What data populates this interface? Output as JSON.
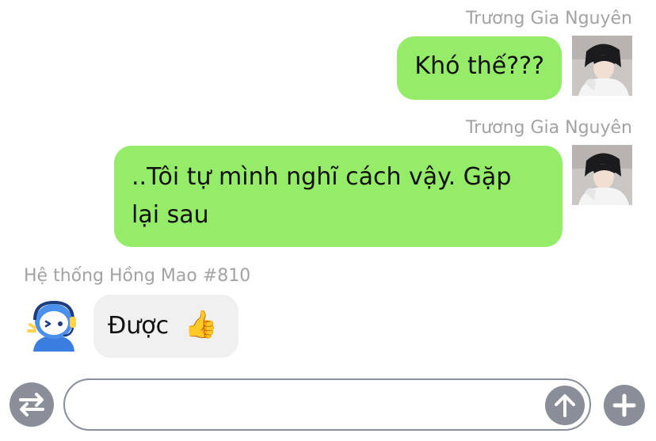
{
  "messages": [
    {
      "sender": "Trương Gia Nguyên",
      "text": "Khó thế???",
      "avatar_icon": "boy-avatar-icon"
    },
    {
      "sender": "Trương Gia Nguyên",
      "text": "..Tôi tự mình nghĩ cách vậy. Gặp lại sau",
      "avatar_icon": "boy-avatar-icon"
    },
    {
      "sender": "Hệ thống Hồng Mao #810",
      "text": "Được",
      "emoji": "👍",
      "avatar_icon": "robot-headset-avatar-icon"
    }
  ],
  "input": {
    "value": "",
    "switch_icon": "switch-arrows-icon",
    "send_icon": "arrow-up-icon",
    "add_icon": "plus-icon"
  },
  "colors": {
    "my_bubble": "#95ec69",
    "their_bubble": "#f0f0f0",
    "name_text": "#a3a3a3",
    "control_gray": "#8a8e99"
  }
}
